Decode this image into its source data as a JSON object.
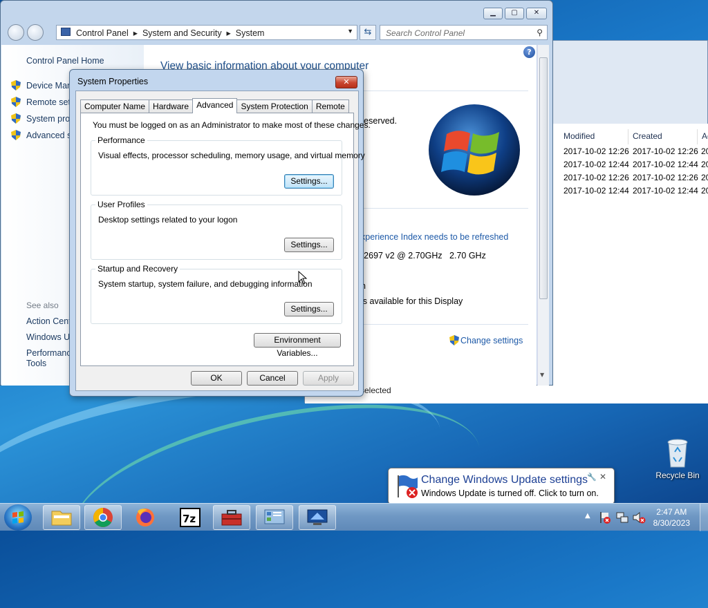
{
  "control_panel": {
    "breadcrumb": [
      "Control Panel",
      "System and Security",
      "System"
    ],
    "search_placeholder": "Search Control Panel",
    "home_link": "Control Panel Home",
    "side_links": [
      "Device Mana",
      "Remote sett",
      "System prot",
      "Advanced sy"
    ],
    "see_also_label": "See also",
    "see_also_links": [
      "Action Cent",
      "Windows Up",
      "Performanc",
      "Tools"
    ],
    "heading": "View basic information about your computer",
    "fragments": {
      "reserved": "reserved.",
      "wei": "xperience Index needs to be refreshed",
      "cpu": "-2697 v2 @ 2.70GHz   2.70 GHz",
      "n": "n",
      "display": "is available for this Display"
    },
    "change_settings": "Change settings"
  },
  "explorer": {
    "columns": [
      "Modified",
      "Created",
      "Ac"
    ],
    "rows": [
      [
        "2017-10-02 12:26",
        "2017-10-02 12:26",
        "20"
      ],
      [
        "2017-10-02 12:44",
        "2017-10-02 12:44",
        "20"
      ],
      [
        "2017-10-02 12:26",
        "2017-10-02 12:26",
        "20"
      ],
      [
        "2017-10-02 12:44",
        "2017-10-02 12:44",
        "20"
      ]
    ],
    "status": "selected"
  },
  "dialog": {
    "title": "System Properties",
    "tabs": [
      "Computer Name",
      "Hardware",
      "Advanced",
      "System Protection",
      "Remote"
    ],
    "active_tab": "Advanced",
    "admin_note": "You must be logged on as an Administrator to make most of these changes.",
    "groups": [
      {
        "label": "Performance",
        "desc": "Visual effects, processor scheduling, memory usage, and virtual memory",
        "button": "Settings..."
      },
      {
        "label": "User Profiles",
        "desc": "Desktop settings related to your logon",
        "button": "Settings..."
      },
      {
        "label": "Startup and Recovery",
        "desc": "System startup, system failure, and debugging information",
        "button": "Settings..."
      }
    ],
    "env_button": "Environment Variables...",
    "ok": "OK",
    "cancel": "Cancel",
    "apply": "Apply"
  },
  "desktop": {
    "recycle_bin": "Recycle Bin"
  },
  "balloon": {
    "title": "Change Windows Update settings",
    "text": "Windows Update is turned off. Click to turn on."
  },
  "taskbar": {
    "time": "2:47 AM",
    "date": "8/30/2023",
    "items": [
      "explorer-icon",
      "chrome-icon",
      "firefox-icon",
      "7zip-icon",
      "toolbox-icon",
      "control-panel-icon",
      "system-icon"
    ]
  }
}
